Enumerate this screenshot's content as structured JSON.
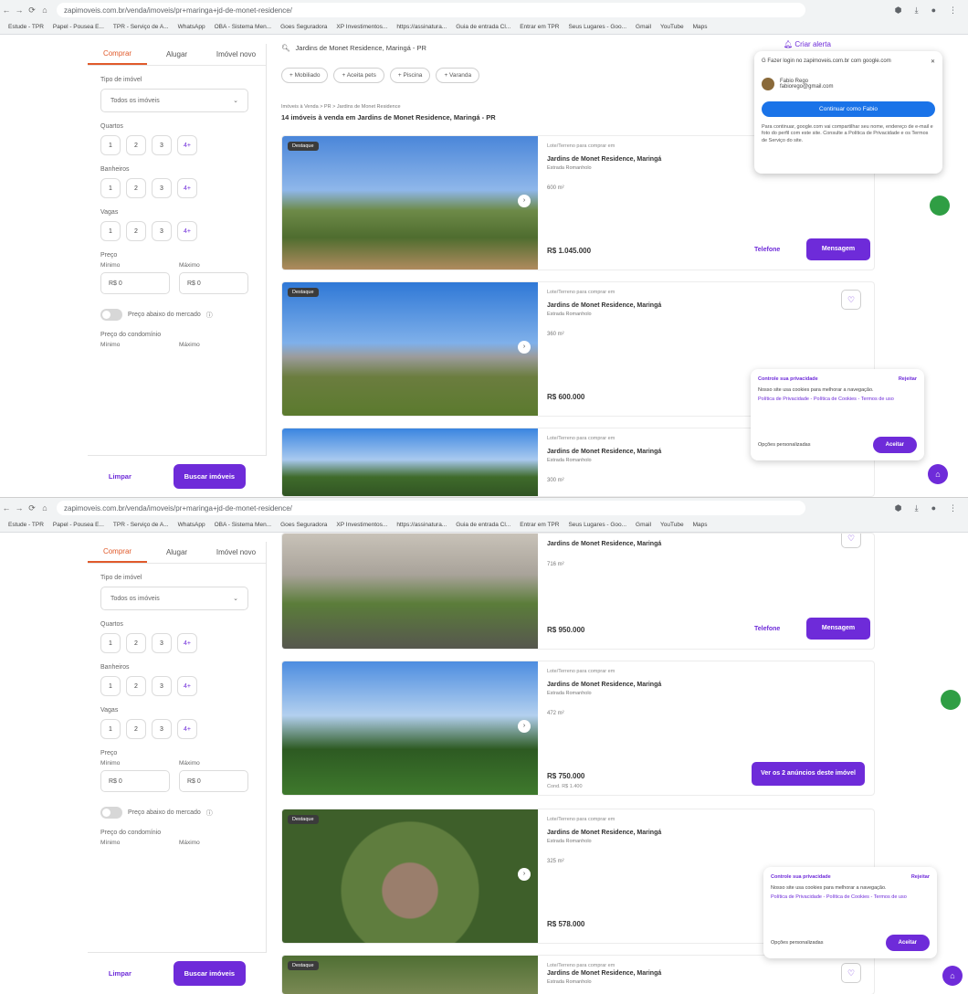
{
  "browser": {
    "url": "zapimoveis.com.br/venda/imoveis/pr+maringa+jd-de-monet-residence/",
    "bookmarks": [
      "Estude - TPR",
      "Papel - Pousea E...",
      "TPR - Serviço de A...",
      "WhatsApp",
      "OBA - Sistema Men...",
      "Goes Seguradora",
      "XP Investimentos...",
      "https://assinatura...",
      "Guia de entrada Cl...",
      "Entrar em TPR",
      "Seus Lugares - Goo...",
      "Gmail",
      "YouTube",
      "Maps"
    ]
  },
  "sidebar": {
    "tabs": [
      "Comprar",
      "Alugar",
      "Imóvel novo"
    ],
    "type_label": "Tipo de imóvel",
    "type_value": "Todos os imóveis",
    "quartos_label": "Quartos",
    "banheiros_label": "Banheiros",
    "vagas_label": "Vagas",
    "chips": [
      "1",
      "2",
      "3",
      "4+"
    ],
    "price_label": "Preço",
    "min_label": "Mínimo",
    "max_label": "Máximo",
    "currency": "R$ 0",
    "toggle_label": "Preço abaixo do mercado",
    "cond_label": "Preço do condomínio",
    "clear_label": "Limpar",
    "search_label": "Buscar imóveis"
  },
  "main": {
    "search_text": "Jardins de Monet Residence, Maringá - PR",
    "alert_label": "Criar alerta",
    "pills": [
      "Mobiliado",
      "Aceita pets",
      "Piscina",
      "Varanda"
    ],
    "breadcrumb": "Imóveis à Venda  >  PR  >  Jardins de Monet Residence",
    "results_title": "14 imóveis à venda em Jardins de Monet Residence, Maringá - PR"
  },
  "listings": [
    {
      "tag": "Lote/Terreno para comprar em",
      "title": "Jardins de Monet Residence, Maringá",
      "hood": "Estrada Romanholo",
      "area": "600 m²",
      "price": "R$ 1.045.000",
      "badge": "Destaque",
      "phone": "Telefone",
      "message": "Mensagem"
    },
    {
      "tag": "Lote/Terreno para comprar em",
      "title": "Jardins de Monet Residence, Maringá",
      "hood": "Estrada Romanholo",
      "area": "360 m²",
      "price": "R$ 600.000",
      "badge": "Destaque"
    },
    {
      "tag": "Lote/Terreno para comprar em",
      "title": "Jardins de Monet Residence, Maringá",
      "hood": "Estrada Romanholo",
      "area": "300 m²"
    },
    {
      "title": "Jardins de Monet Residence, Maringá",
      "area": "716 m²",
      "price": "R$ 950.000",
      "phone": "Telefone",
      "message": "Mensagem"
    },
    {
      "tag": "Lote/Terreno para comprar em",
      "title": "Jardins de Monet Residence, Maringá",
      "hood": "Estrada Romanholo",
      "area": "472 m²",
      "price": "R$ 750.000",
      "cond": "Cond. R$ 1.400",
      "see_more": "Ver os 2 anúncios deste imóvel"
    },
    {
      "tag": "Lote/Terreno para comprar em",
      "title": "Jardins de Monet Residence, Maringá",
      "hood": "Estrada Romanholo",
      "area": "325 m²",
      "price": "R$ 578.000",
      "badge": "Destaque"
    },
    {
      "tag": "Lote/Terreno para comprar em",
      "title": "Jardins de Monet Residence, Maringá",
      "hood": "Estrada Romanholo",
      "badge": "Destaque"
    }
  ],
  "google_popup": {
    "title": "Fazer login no zapimoveis.com.br com google.com",
    "name": "Fabio Rego",
    "email": "fabiorego@gmail.com",
    "button": "Continuar como Fabio",
    "text": "Para continuar, google.com vai compartilhar seu nome, endereço de e-mail e foto do perfil com este site. Consulte a Política de Privacidade e os Termos de Serviço do site."
  },
  "privacy": {
    "title": "Controle sua privacidade",
    "reject": "Rejeitar",
    "text": "Nosso site usa cookies para melhorar a navegação.",
    "links": "Política de Privacidade - Política de Cookies - Termos de uso",
    "options": "Opções personalizadas",
    "accept": "Aceitar"
  }
}
